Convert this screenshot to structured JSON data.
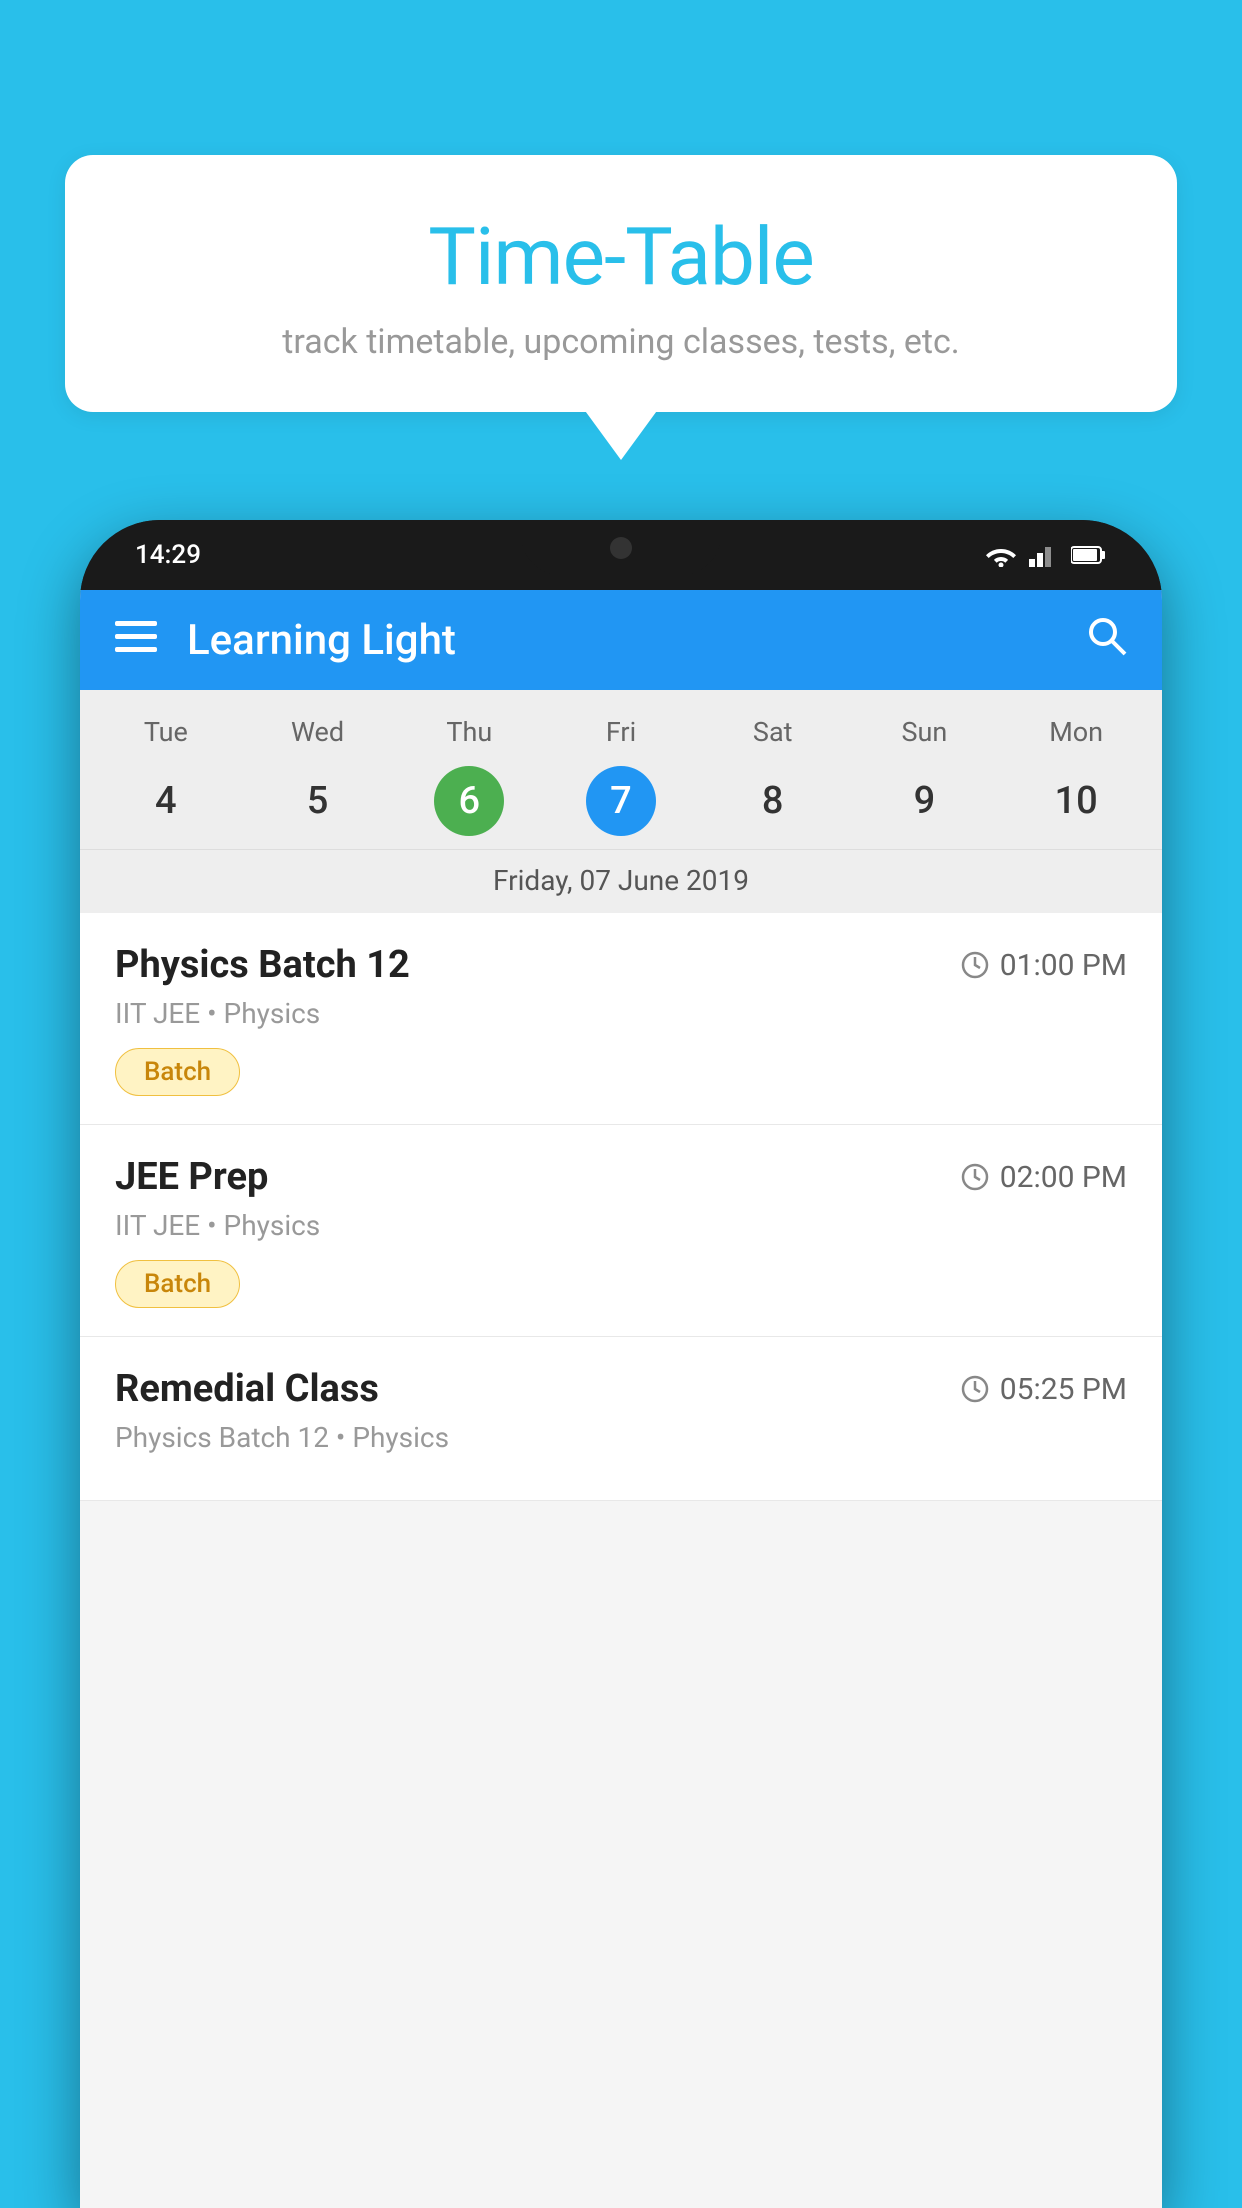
{
  "background": {
    "color": "#29BFEA"
  },
  "speech_bubble": {
    "title": "Time-Table",
    "subtitle": "track timetable, upcoming classes, tests, etc."
  },
  "phone": {
    "status_bar": {
      "time": "14:29",
      "wifi": "wifi",
      "signal": "signal",
      "battery": "battery"
    },
    "app_header": {
      "menu_icon": "≡",
      "title": "Learning Light",
      "search_icon": "🔍"
    },
    "calendar": {
      "days": [
        "Tue",
        "Wed",
        "Thu",
        "Fri",
        "Sat",
        "Sun",
        "Mon"
      ],
      "dates": [
        "4",
        "5",
        "6",
        "7",
        "8",
        "9",
        "10"
      ],
      "today_index": 2,
      "selected_index": 3,
      "selected_date_label": "Friday, 07 June 2019"
    },
    "schedule_items": [
      {
        "title": "Physics Batch 12",
        "time": "01:00 PM",
        "meta": "IIT JEE • Physics",
        "badge": "Batch"
      },
      {
        "title": "JEE Prep",
        "time": "02:00 PM",
        "meta": "IIT JEE • Physics",
        "badge": "Batch"
      },
      {
        "title": "Remedial Class",
        "time": "05:25 PM",
        "meta": "Physics Batch 12 • Physics",
        "badge": null
      }
    ]
  }
}
